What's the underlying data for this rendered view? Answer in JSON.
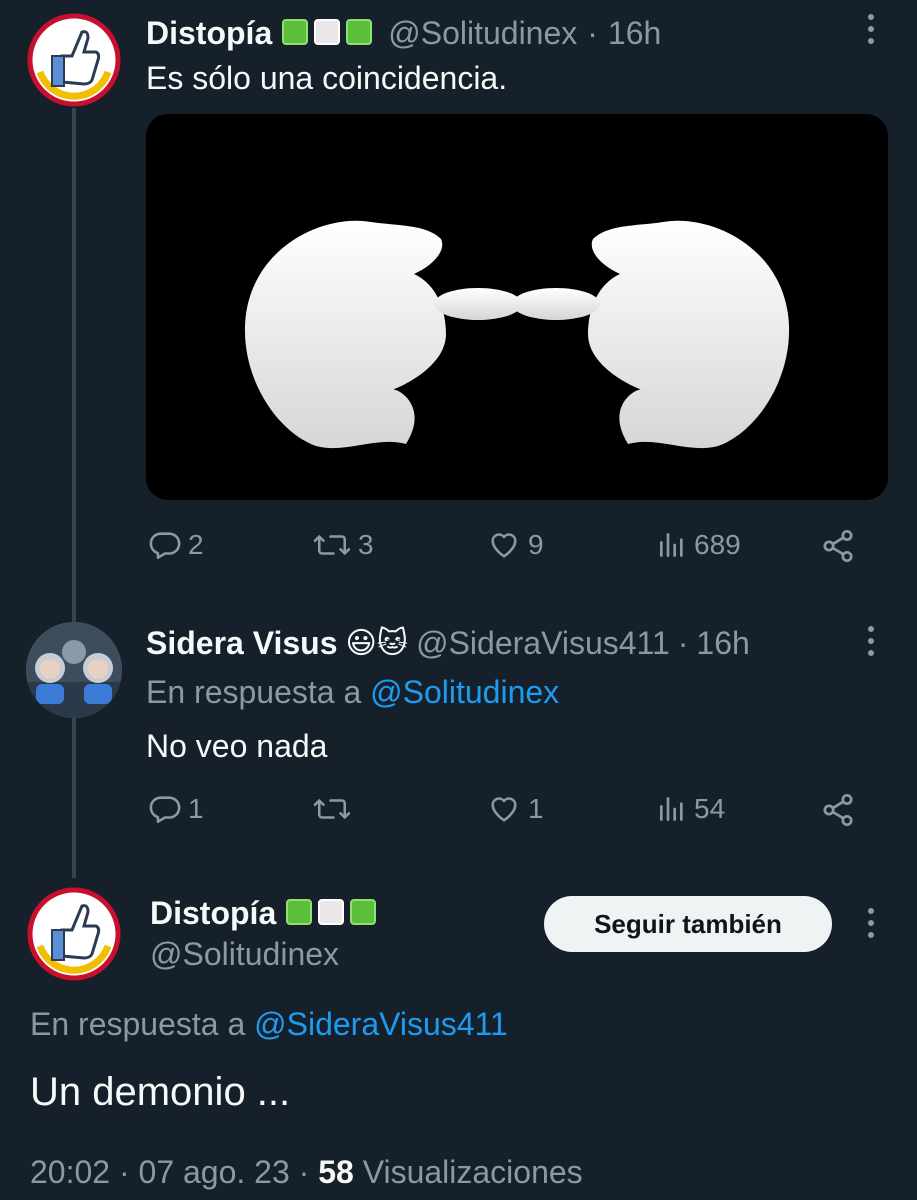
{
  "tweet1": {
    "name": "Distopía",
    "handle": "@Solitudinex",
    "time": "16h",
    "text": "Es sólo una coincidencia.",
    "replies": "2",
    "retweets": "3",
    "likes": "9",
    "views": "689"
  },
  "tweet2": {
    "name": "Sidera Visus",
    "emoji": "😃🐱",
    "handle": "@SideraVisus411",
    "time": "16h",
    "reply_prefix": "En respuesta a ",
    "reply_to": "@Solitudinex",
    "text": "No veo nada",
    "replies": "1",
    "likes": "1",
    "views": "54"
  },
  "tweet3": {
    "name": "Distopía",
    "handle": "@Solitudinex",
    "follow_label": "Seguir también",
    "reply_prefix": "En respuesta a ",
    "reply_to": "@SideraVisus411",
    "text": "Un demonio ...",
    "timestamp": "20:02 · 07 ago. 23 · ",
    "views_count": "58",
    "views_label": " Visualizaciones"
  },
  "icons": [
    "reply-icon",
    "retweet-icon",
    "like-icon",
    "views-icon",
    "share-icon",
    "more-icon"
  ],
  "colors": {
    "background": "#15202b",
    "text": "#f7f9f9",
    "muted": "#8b98a5",
    "link": "#1d9bf0",
    "flag_green": "#5bbf3a"
  }
}
